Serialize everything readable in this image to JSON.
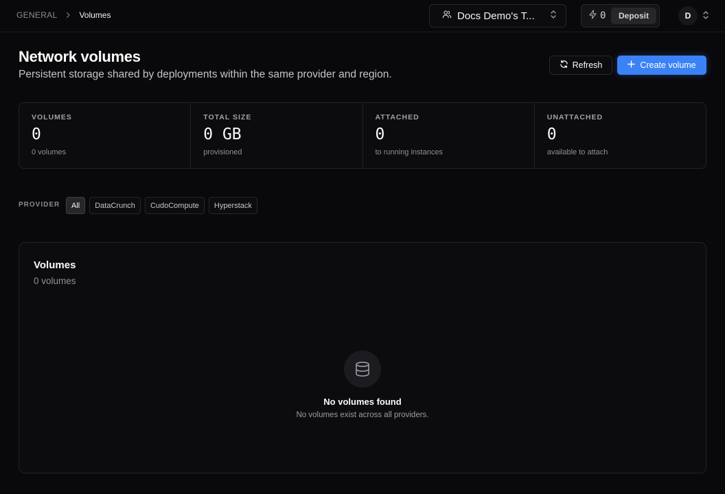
{
  "breadcrumb": {
    "section": "GENERAL",
    "current": "Volumes"
  },
  "team_switcher": {
    "label": "Docs Demo's T...",
    "icon": "users-icon"
  },
  "credits": {
    "value": "0",
    "deposit_label": "Deposit",
    "icon": "lightning-icon"
  },
  "user": {
    "initial": "D"
  },
  "header": {
    "title": "Network volumes",
    "subtitle": "Persistent storage shared by deployments within the same provider and region.",
    "refresh_label": "Refresh",
    "create_label": "Create volume"
  },
  "stats": [
    {
      "key": "VOLUMES",
      "value": "0",
      "desc": "0 volumes"
    },
    {
      "key": "TOTAL SIZE",
      "value": "0 GB",
      "desc": "provisioned"
    },
    {
      "key": "ATTACHED",
      "value": "0",
      "desc": "to running instances"
    },
    {
      "key": "UNATTACHED",
      "value": "0",
      "desc": "available to attach"
    }
  ],
  "provider_filter": {
    "label": "PROVIDER",
    "options": [
      "All",
      "DataCrunch",
      "CudoCompute",
      "Hyperstack"
    ],
    "selected": "All"
  },
  "volumes_panel": {
    "title": "Volumes",
    "count": "0 volumes",
    "empty_title": "No volumes found",
    "empty_desc": "No volumes exist across all providers.",
    "empty_icon": "database-icon"
  },
  "colors": {
    "accent": "#3b82f6",
    "background": "#09090b",
    "surface": "#0c0c0f",
    "border": "#232327"
  }
}
